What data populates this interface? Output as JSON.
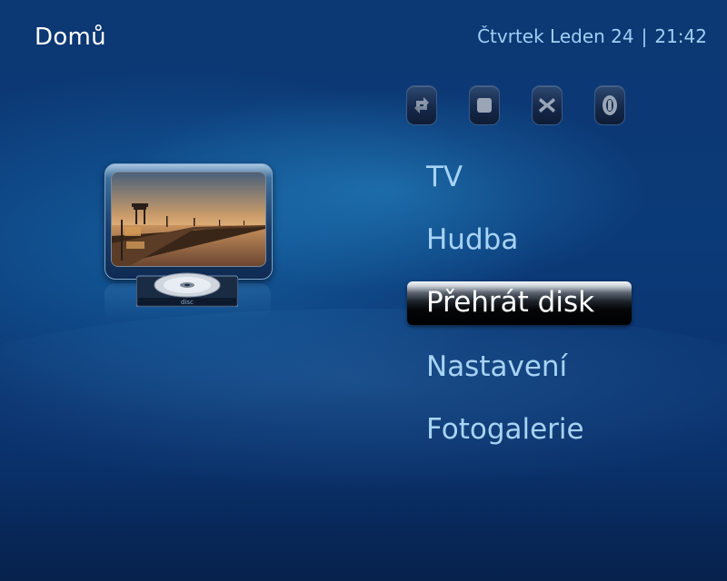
{
  "header": {
    "title": "Domů",
    "date": "Čtvrtek Leden 24",
    "separator": "|",
    "time": "21:42"
  },
  "transport_controls": [
    {
      "name": "repeat-icon"
    },
    {
      "name": "stop-icon"
    },
    {
      "name": "close-icon"
    },
    {
      "name": "eject-icon"
    }
  ],
  "menu": {
    "items": [
      {
        "label": "TV",
        "selected": false
      },
      {
        "label": "Hudba",
        "selected": false
      },
      {
        "label": "Přehrát disk",
        "selected": true
      },
      {
        "label": "Nastavení",
        "selected": false
      },
      {
        "label": "Fotogalerie",
        "selected": false
      }
    ]
  },
  "preview": {
    "image": "tv-with-pier-sunset-and-disc",
    "disc_label": "disc"
  },
  "colors": {
    "background": "#0b3a78",
    "menu_text": "#a7d3f5",
    "selected_text": "#ffffff",
    "datetime_text": "#9fd0f3"
  }
}
